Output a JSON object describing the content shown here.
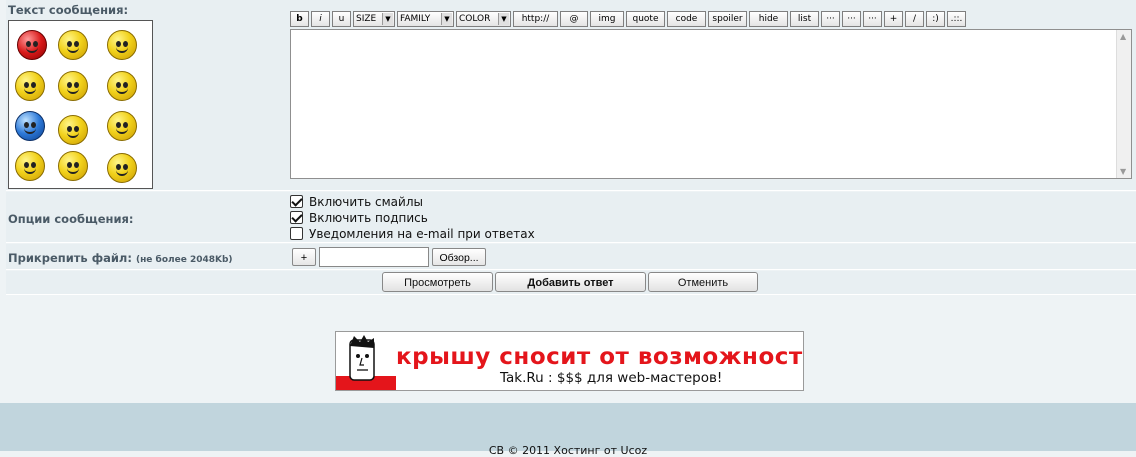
{
  "message": {
    "label": "Текст сообщения:"
  },
  "smiles": [
    "angry-smile",
    "sleepy-smile",
    "sick-smile",
    "crying-smile",
    "surprised-smile",
    "grinning-smile",
    "frozen-smile",
    "squint-smile",
    "bored-smile",
    "laughing-smile",
    "nerd-smile",
    "grin-smile"
  ],
  "toolbar": {
    "bold": "b",
    "italic": "i",
    "underline": "u",
    "size": "SIZE",
    "family": "FAMILY",
    "color": "COLOR",
    "url": "http://",
    "email": "@",
    "img": "img",
    "quote": "quote",
    "code": "code",
    "spoiler": "spoiler",
    "hide": "hide",
    "list": "list",
    "dots1": "···",
    "dots2": "···",
    "dots3": "···",
    "plus": "+",
    "slash": "/",
    "smile": ":)",
    "more": ".::."
  },
  "options": {
    "label": "Опции сообщения:",
    "enable_smiles": "Включить смайлы",
    "enable_signature": "Включить подпись",
    "email_notify": "Уведомления на e-mail при ответах"
  },
  "attach": {
    "label": "Прикрепить файл:",
    "limit": "(не более 2048Kb)",
    "plus": "+",
    "browse": "Обзор..."
  },
  "actions": {
    "preview": "Просмотреть",
    "submit": "Добавить ответ",
    "cancel": "Отменить"
  },
  "banner": {
    "headline": "крышу сносит от возможностей...",
    "tagline": "Tak.Ru : $$$ для web-мастеров!"
  },
  "footer": {
    "copyright": "CB © 2011 Хостинг от Ucoz"
  }
}
